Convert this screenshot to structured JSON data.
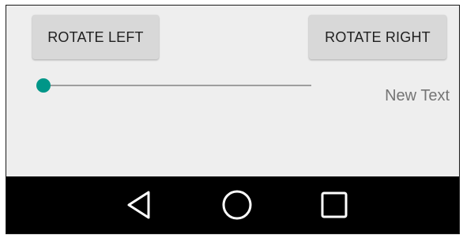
{
  "buttons": {
    "rotate_left": "ROTATE LEFT",
    "rotate_right": "ROTATE RIGHT"
  },
  "seekbar": {
    "progress": 0.0,
    "accent_color": "#009688"
  },
  "text_view": {
    "text": "New Text"
  },
  "navigation_bar": {
    "icons": [
      "back-icon",
      "home-icon",
      "recents-icon"
    ]
  },
  "colors": {
    "background": "#eeeeee",
    "button": "#d8d8d8",
    "navbar": "#000000"
  }
}
